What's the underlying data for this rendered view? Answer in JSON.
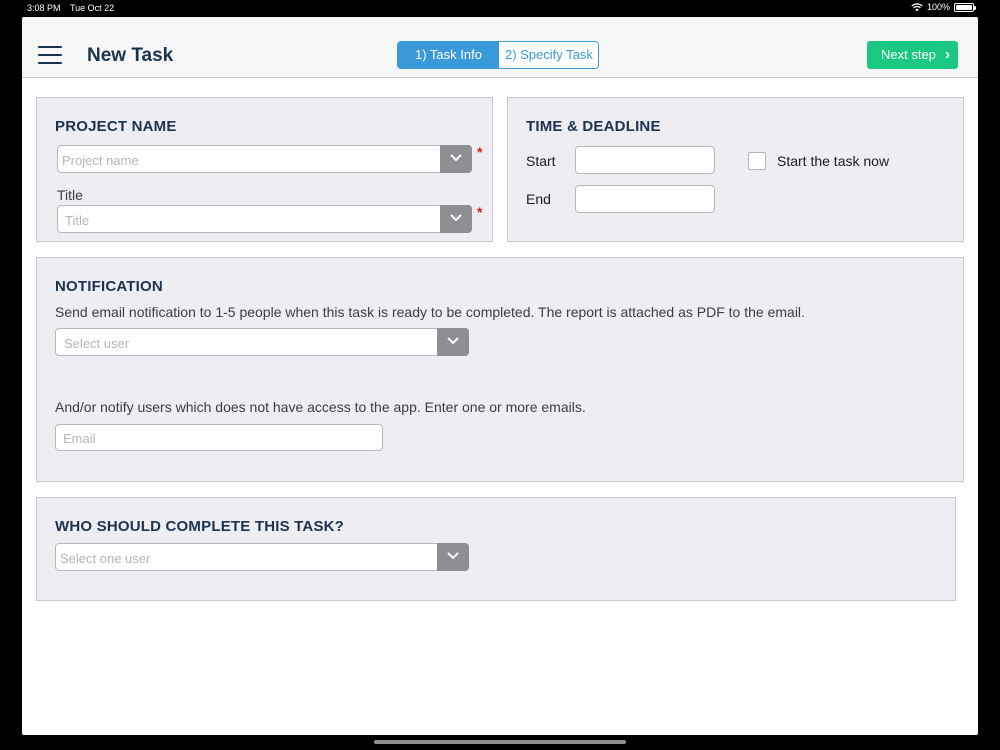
{
  "status_bar": {
    "time": "3:08 PM",
    "date": "Tue Oct 22",
    "battery": "100%"
  },
  "navbar": {
    "title": "New Task",
    "steps": [
      {
        "label": "1) Task Info",
        "active": true
      },
      {
        "label": "2) Specify Task",
        "active": false
      }
    ],
    "next_label": "Next step",
    "next_color": "#1bc87f",
    "accent_color": "#3a9ad9"
  },
  "project": {
    "heading": "PROJECT NAME",
    "project_placeholder": "Project name",
    "title_label": "Title",
    "title_placeholder": "Title",
    "required_mark": "*"
  },
  "time": {
    "heading": "TIME & DEADLINE",
    "start_label": "Start",
    "end_label": "End",
    "start_value": "",
    "end_value": "",
    "start_now_label": "Start the task now"
  },
  "notification": {
    "heading": "NOTIFICATION",
    "description": "Send email notification to 1-5 people when this task is ready to be completed. The report is attached as PDF to the email.",
    "user_placeholder": "Select user",
    "email_description": "And/or notify users which does not have access to the app. Enter one or more emails.",
    "email_placeholder": "Email"
  },
  "assignee": {
    "heading": "WHO SHOULD COMPLETE THIS TASK?",
    "placeholder": "Select one user"
  }
}
